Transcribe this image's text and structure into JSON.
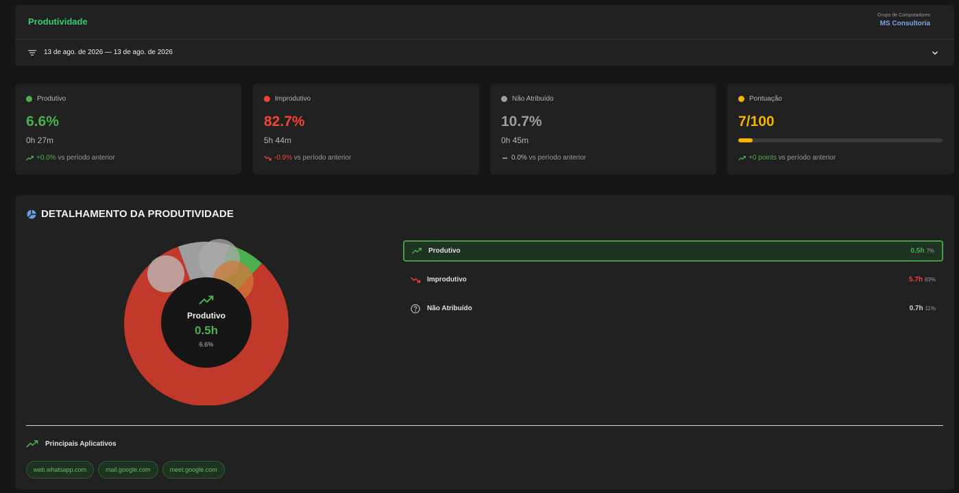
{
  "header": {
    "title": "Produtividade",
    "group_label": "Grupo de Computadores",
    "group_value": "MS Consultoria",
    "date_range": "13 de ago. de 2026 — 13 de ago. de 2026"
  },
  "stats": [
    {
      "label": "Produtivo",
      "value": "6.6%",
      "sub": "0h 27m",
      "delta": "+0.0%",
      "suffix": "vs período anterior",
      "color": "#4caf50"
    },
    {
      "label": "Improdutivo",
      "value": "82.7%",
      "sub": "5h 44m",
      "delta": "-0.9%",
      "suffix": "vs período anterior",
      "color": "#f44336"
    },
    {
      "label": "Não Atribuído",
      "value": "10.7%",
      "sub": "0h 45m",
      "delta": "0.0%",
      "suffix": "vs período anterior",
      "color": "#9e9e9e"
    },
    {
      "label": "Pontuação",
      "value": "7/100",
      "score_fraction": 0.07,
      "delta": "+0 points",
      "suffix": "vs período anterior",
      "color": "#f5b300"
    }
  ],
  "breakdown": {
    "title": "DETALHAMENTO DA PRODUTIVIDADE",
    "center": {
      "label": "Produtivo",
      "value": "0.5h",
      "pct": "6.6%"
    },
    "legend": [
      {
        "label": "Produtivo",
        "hours": "0.5h",
        "pct": "7%",
        "color": "#4caf50"
      },
      {
        "label": "Improdutivo",
        "hours": "5.7h",
        "pct": "83%",
        "color": "#f44336"
      },
      {
        "label": "Não Atribuído",
        "hours": "0.7h",
        "pct": "11%",
        "color": "#bdbdbd"
      }
    ],
    "apps_title": "Principais Aplicativos",
    "apps": [
      "web.whatsapp.com",
      "mail.google.com",
      "meet.google.com"
    ]
  },
  "chart_data": {
    "type": "pie",
    "categories": [
      "Produtivo",
      "Improdutivo",
      "Não Atribuído"
    ],
    "values": [
      0.5,
      5.7,
      0.7
    ],
    "colors": [
      "#4caf50",
      "#c0392b",
      "#9e9e9e"
    ]
  }
}
